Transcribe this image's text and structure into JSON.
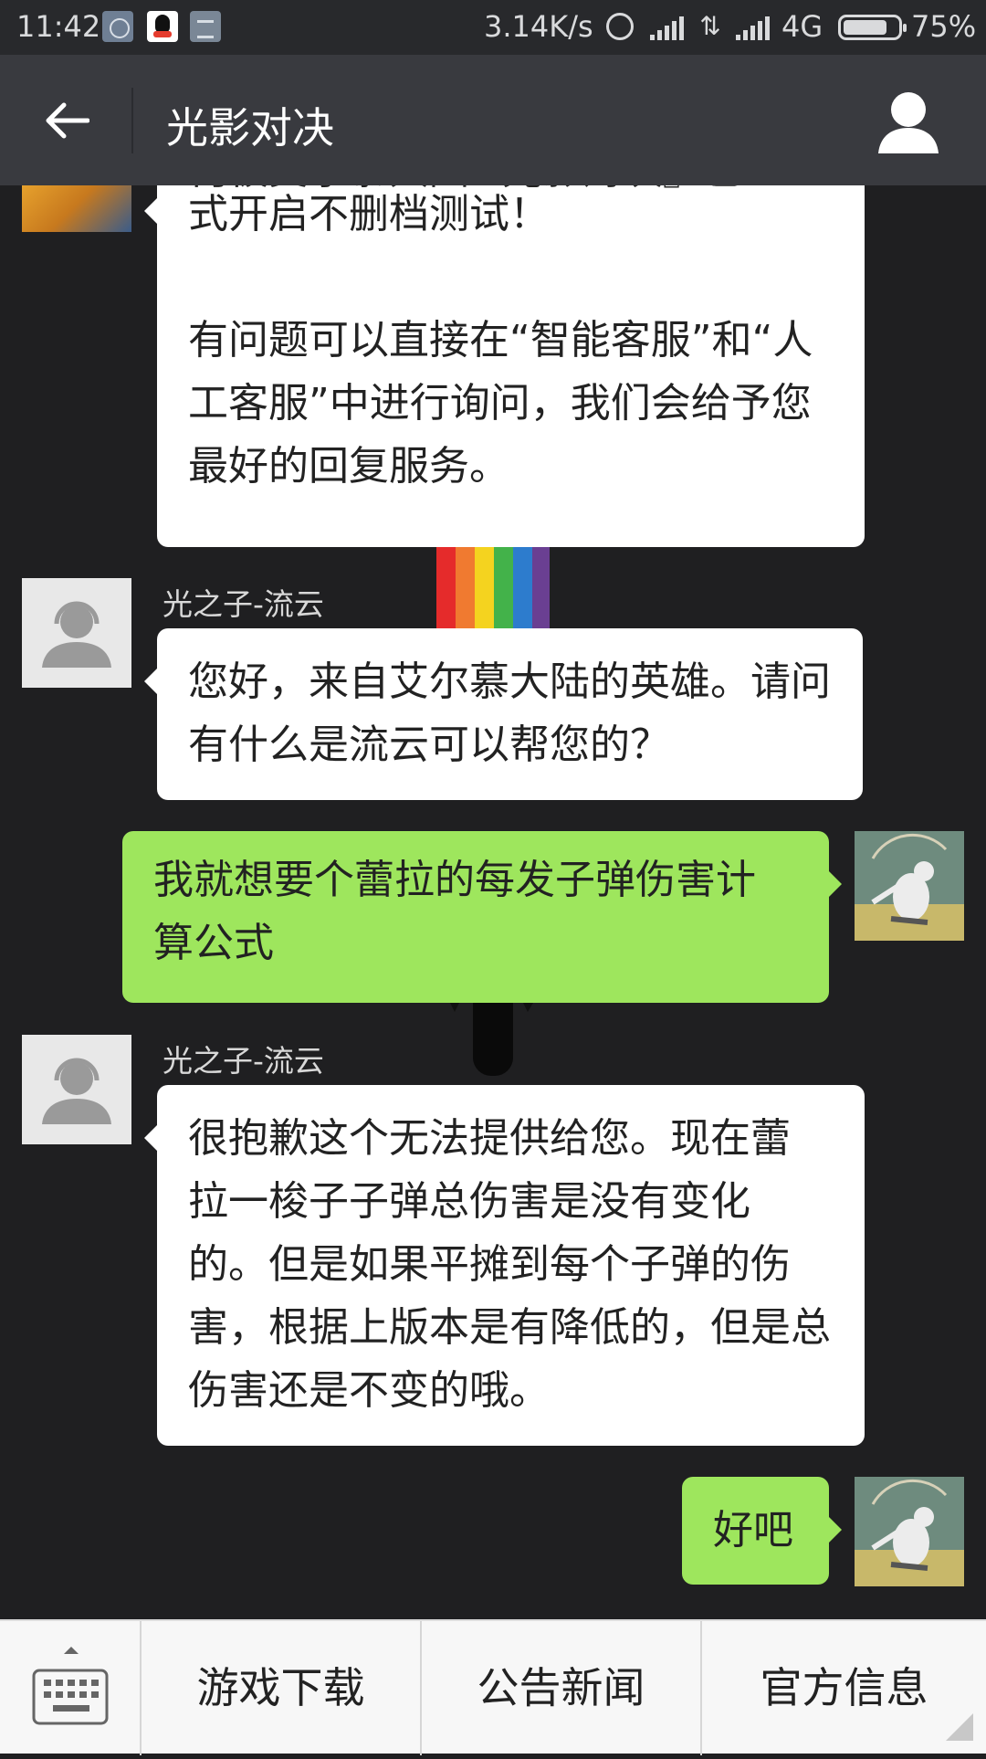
{
  "status_bar": {
    "time": "11:42",
    "speed": "3.14K/s",
    "network": "4G",
    "battery": "75%",
    "icons": [
      "clock-icon",
      "qq-icon",
      "message-icon",
      "alarm-icon",
      "signal-icon",
      "data-icon",
      "battery-icon"
    ]
  },
  "header": {
    "title": "光影对决",
    "back_icon": "arrow-left-icon",
    "profile_icon": "person-icon"
  },
  "messages": [
    {
      "from": "service",
      "lines": [
        "式开启不删档测试！",
        "",
        "有问题可以直接在“智能客服”和“人",
        "工客服”中进行询问，我们会给予您",
        "最好的回复服务。"
      ]
    },
    {
      "from": "service",
      "sender": "光之子-流云",
      "lines": [
        "您好，来自艾尔慕大陆的英雄。请问",
        "有什么是流云可以帮您的？"
      ]
    },
    {
      "from": "me",
      "lines": [
        "我就想要个蕾拉的每发子弹伤害计",
        "算公式"
      ]
    },
    {
      "from": "service",
      "sender": "光之子-流云",
      "lines": [
        "很抱歉这个无法提供给您。现在蕾",
        "拉一梭子子弹总伤害是没有变化",
        "的。但是如果平摊到每个子弹的伤",
        "害，根据上版本是有降低的，但是总",
        "伤害还是不变的哦。"
      ]
    },
    {
      "from": "me",
      "lines": [
        "好吧"
      ]
    }
  ],
  "menu": {
    "keyboard_icon": "keyboard-icon",
    "tabs": [
      "游戏下载",
      "公告新闻",
      "官方信息"
    ]
  },
  "colors": {
    "status_bar": "#28292c",
    "title_bar": "#393a3f",
    "chat_bg": "#1f1f21",
    "bubble_in": "#ffffff",
    "bubble_out": "#9ee65d"
  }
}
